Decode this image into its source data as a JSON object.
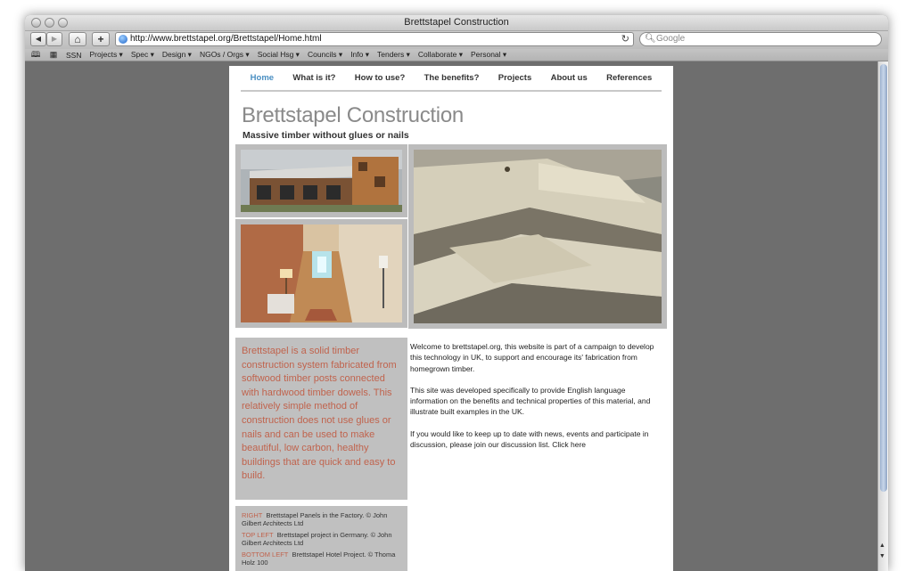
{
  "window": {
    "title": "Brettstapel Construction"
  },
  "toolbar": {
    "url": "http://www.brettstapel.org/Brettstapel/Home.html",
    "search_placeholder": "Google",
    "back_icon": "◀",
    "forward_icon": "▶",
    "home_icon": "⌂",
    "add_icon": "+",
    "reload_icon": "↻"
  },
  "bookmarks": {
    "items": [
      {
        "label": "SSN"
      },
      {
        "label": "Projects ▾"
      },
      {
        "label": "Spec ▾"
      },
      {
        "label": "Design ▾"
      },
      {
        "label": "NGOs / Orgs ▾"
      },
      {
        "label": "Social Hsg ▾"
      },
      {
        "label": "Councils ▾"
      },
      {
        "label": "Info ▾"
      },
      {
        "label": "Tenders ▾"
      },
      {
        "label": "Collaborate ▾"
      },
      {
        "label": "Personal ▾"
      }
    ]
  },
  "site": {
    "nav": [
      {
        "label": "Home",
        "active": true
      },
      {
        "label": "What is it?"
      },
      {
        "label": "How to use?"
      },
      {
        "label": "The benefits?"
      },
      {
        "label": "Projects"
      },
      {
        "label": "About us"
      },
      {
        "label": "References"
      }
    ],
    "title": "Brettstapel Construction",
    "tagline": "Massive timber without glues or nails",
    "intro": "Brettstapel is a solid timber construction system fabricated from softwood timber posts connected with hardwood timber dowels.  This relatively simple method of construction does not use glues or nails and can be used to make beautiful, low carbon, healthy buildings that are quick and easy to build.",
    "paragraphs": [
      "Welcome to brettstapel.org, this website is part of a campaign to develop this technology in UK, to support and encourage its' fabrication from homegrown timber.",
      "This site was developed specifically to provide English language information on the benefits and technical properties of this material, and illustrate built examples in the UK.",
      "If you would like to keep up to date with news, events and participate in discussion, please join our discussion list. Click here"
    ],
    "captions": [
      {
        "label": "RIGHT",
        "text": "Brettstapel Panels in the Factory. © John Gilbert Architects Ltd"
      },
      {
        "label": "TOP LEFT",
        "text": "Brettstapel project in Germany. © John Gilbert Architects Ltd"
      },
      {
        "label": "BOTTOM LEFT",
        "text": "Brettstapel Hotel Project. © Thoma Holz 100"
      }
    ]
  },
  "colors": {
    "accent": "#4a8fc2",
    "intro_text": "#c0634d",
    "panel": "#c0c0c0"
  }
}
